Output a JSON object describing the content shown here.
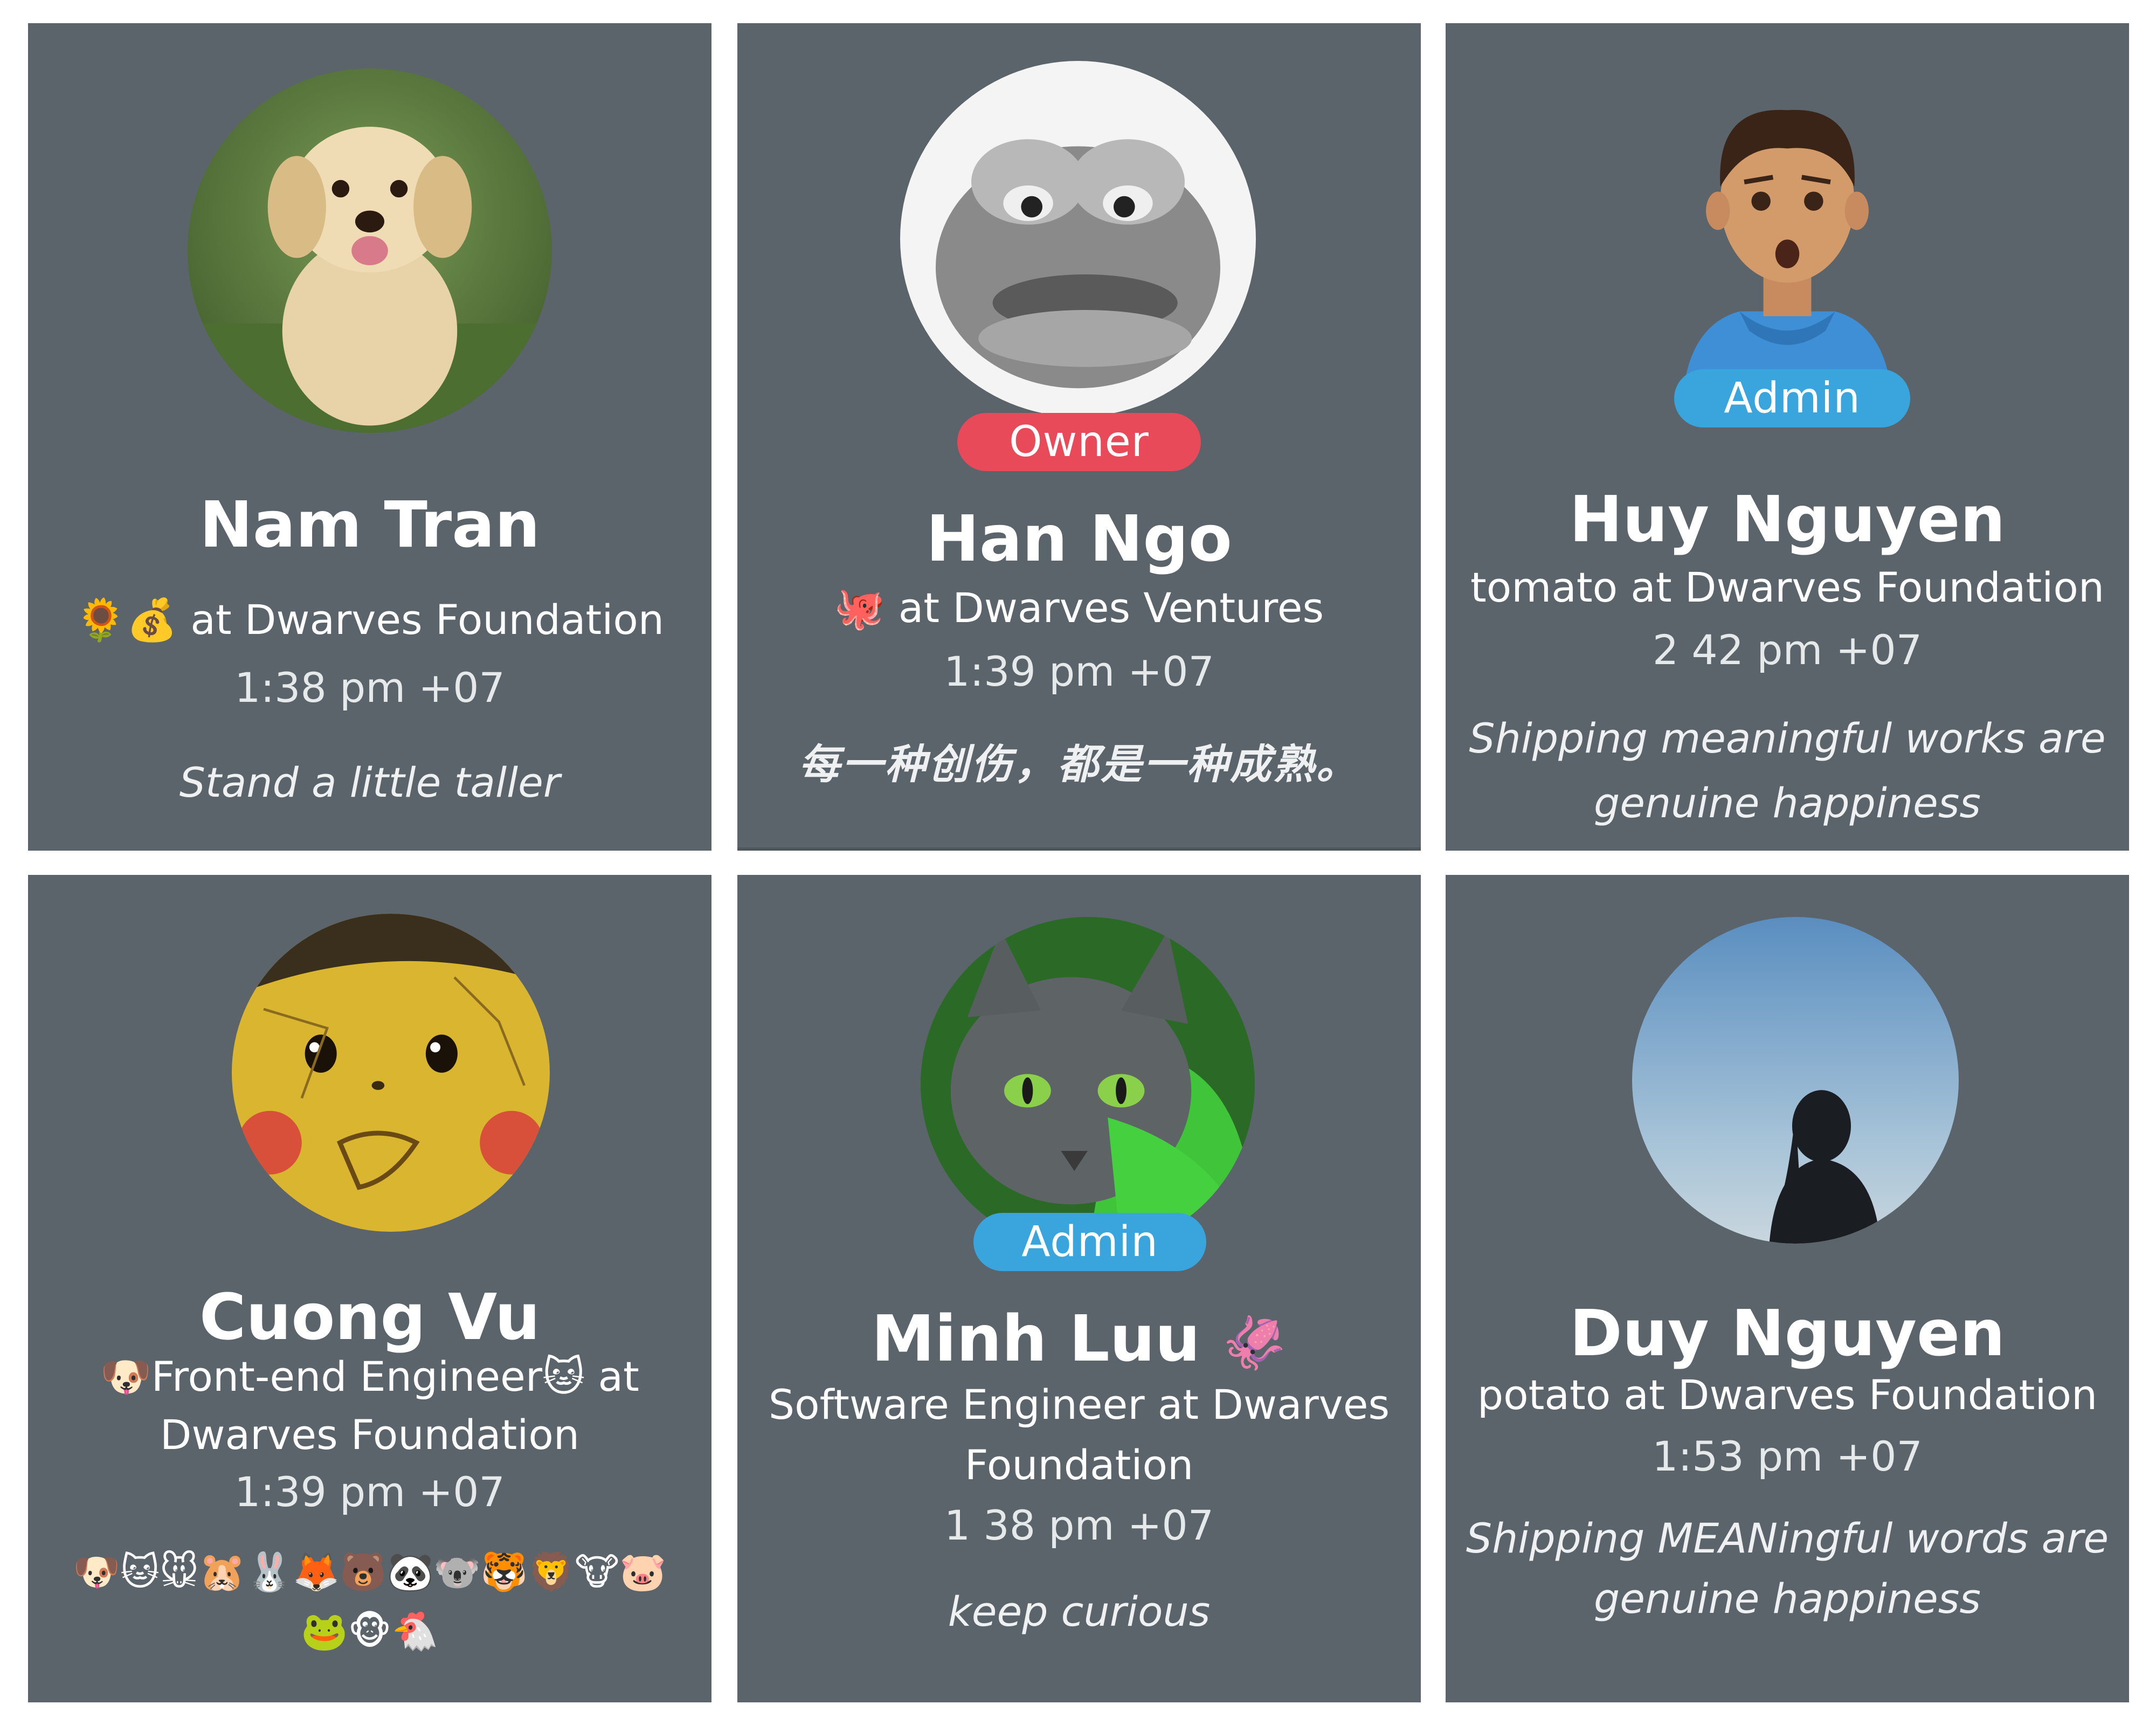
{
  "members": [
    {
      "name": "Nam Tran",
      "role_badge": "",
      "title_emoji": "🌻💰",
      "title_text": "at Dwarves Foundation",
      "time": "1:38 pm +07",
      "bio": "Stand a little taller",
      "avatar_icon": "puppy-photo-avatar"
    },
    {
      "name": "Han Ngo",
      "role_badge": "Owner",
      "title_emoji": "🐙",
      "title_text": "at Dwarves Ventures",
      "time": "1:39 pm +07",
      "bio": "每一种创伤，都是一种成熟。",
      "avatar_icon": "pepe-frog-avatar"
    },
    {
      "name": "Huy Nguyen",
      "role_badge": "Admin",
      "title_text": "tomato at Dwarves Foundation",
      "time": "2 42 pm +07",
      "bio_line1": "Shipping meaningful works are",
      "bio_line2": "genuine happiness",
      "avatar_icon": "cartoon-boy-avatar"
    },
    {
      "name": "Cuong Vu",
      "role_badge": "",
      "title_line1": "🐶Front-end Engineer🐱 at",
      "title_line2": "Dwarves Foundation",
      "time": "1:39 pm +07",
      "emoji_line1": "🐶🐱🐭🐹🐰🦊🐻🐼🐨🐯🦁🐮🐷",
      "emoji_line2": "🐸🐵🐔",
      "avatar_icon": "pikachu-avatar"
    },
    {
      "name": "Minh Luu",
      "name_emoji": "🦑",
      "role_badge": "Admin",
      "title_line1": "Software Engineer at Dwarves",
      "title_line2": "Foundation",
      "time": "1 38 pm +07",
      "bio": "keep curious",
      "avatar_icon": "cat-photo-avatar"
    },
    {
      "name": "Duy Nguyen",
      "role_badge": "",
      "title_text": "potato at Dwarves Foundation",
      "time": "1:53 pm +07",
      "bio_line1": "Shipping MEANingful words are",
      "bio_line2": "genuine happiness",
      "avatar_icon": "silhouette-sky-avatar"
    }
  ],
  "colors": {
    "card_bg": "#5a646a",
    "owner_badge": "#e84a5a",
    "admin_badge": "#3aa4dc"
  }
}
